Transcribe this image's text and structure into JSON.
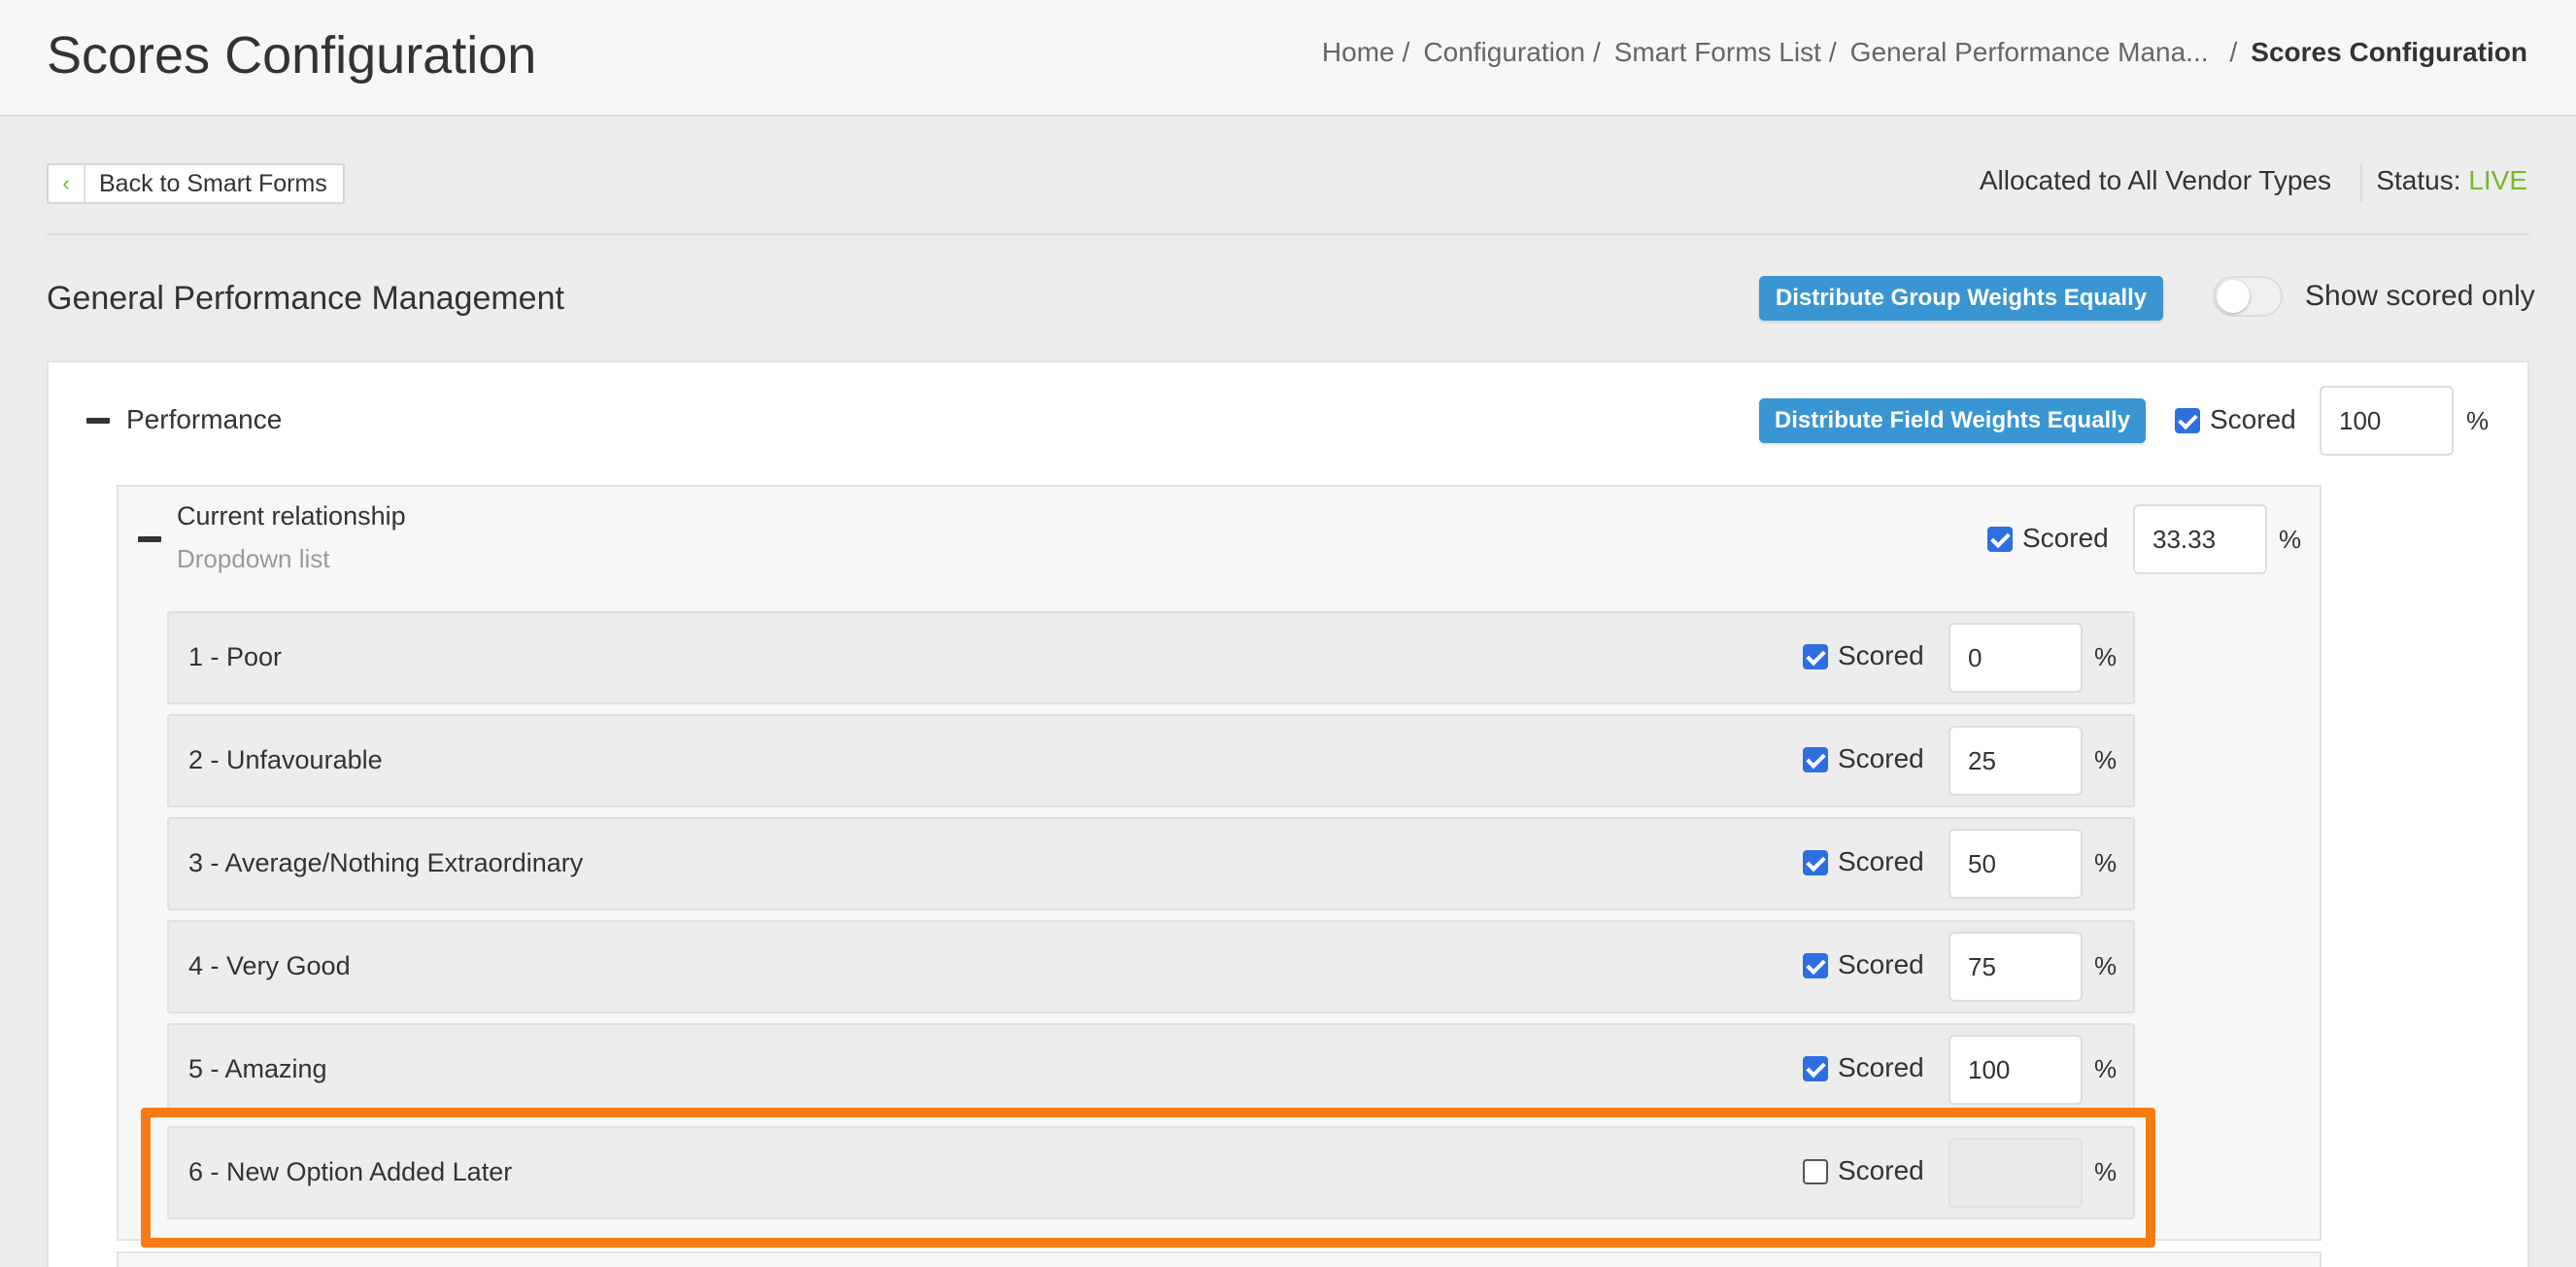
{
  "header": {
    "title": "Scores Configuration",
    "breadcrumb": [
      "Home",
      "Configuration",
      "Smart Forms List",
      "General Performance Mana...",
      "Scores Configuration"
    ],
    "separator": "/"
  },
  "toolbar": {
    "back_label": "Back to Smart Forms",
    "back_icon": "chevron-left-icon",
    "allocation": "Allocated to All Vendor Types",
    "status_label": "Status:",
    "status_value": "LIVE",
    "status_color": "#76b82a"
  },
  "form": {
    "title": "General Performance Management",
    "distribute_group_label": "Distribute Group Weights Equally",
    "show_scored_label": "Show scored only",
    "show_scored_on": false,
    "button_color": "#3a96d3"
  },
  "group": {
    "name": "Performance",
    "distribute_field_label": "Distribute Field Weights Equally",
    "scored_label": "Scored",
    "scored": true,
    "weight": "100",
    "pct": "%"
  },
  "field": {
    "name": "Current relationship",
    "type": "Dropdown list",
    "scored_label": "Scored",
    "scored": true,
    "weight": "33.33",
    "pct": "%"
  },
  "options": [
    {
      "label": "1 - Poor",
      "scored_label": "Scored",
      "scored": true,
      "weight": "0",
      "pct": "%"
    },
    {
      "label": "2 - Unfavourable",
      "scored_label": "Scored",
      "scored": true,
      "weight": "25",
      "pct": "%"
    },
    {
      "label": "3 - Average/Nothing Extraordinary",
      "scored_label": "Scored",
      "scored": true,
      "weight": "50",
      "pct": "%"
    },
    {
      "label": "4 - Very Good",
      "scored_label": "Scored",
      "scored": true,
      "weight": "75",
      "pct": "%"
    },
    {
      "label": "5 - Amazing",
      "scored_label": "Scored",
      "scored": true,
      "weight": "100",
      "pct": "%"
    },
    {
      "label": "6 - New Option Added Later",
      "scored_label": "Scored",
      "scored": false,
      "weight": "",
      "pct": "%"
    }
  ],
  "highlight_color": "#f97a12"
}
